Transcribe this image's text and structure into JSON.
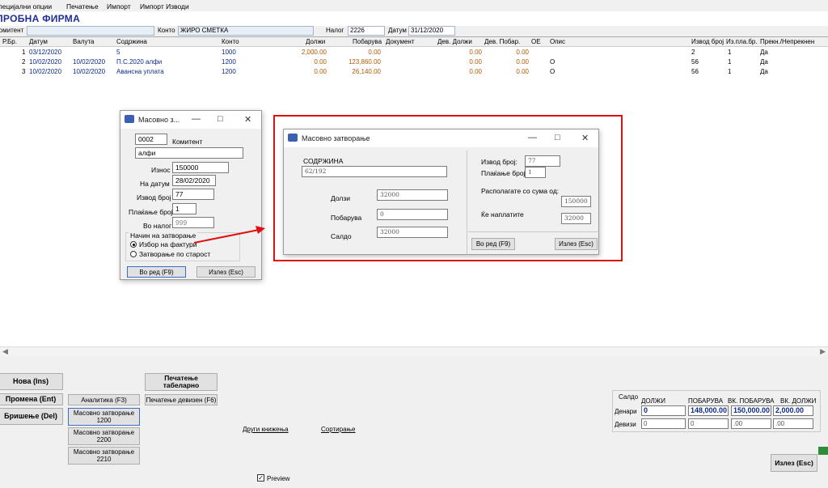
{
  "menu": [
    "Специјални опции",
    "Печатење",
    "Импорт",
    "Импорт Изводи"
  ],
  "company": "ПРОБНА ФИРМА",
  "filter": {
    "komitent_label": "Комитент",
    "konto_label": "Конто",
    "konto_value": "ЖИРО СМЕТКА",
    "nalog_label": "Налог",
    "nalog_value": "2226",
    "datum_label": "Датум",
    "datum_value": "31/12/2020"
  },
  "grid": {
    "headers": [
      "Р.Бр.",
      "Датум",
      "Валута",
      "Содржина",
      "Конто",
      "Должи",
      "Побарува",
      "Документ",
      "Дев. Должи",
      "Дев. Побар.",
      "ОЕ",
      "Опис",
      "Извод број",
      "Из.пла.бр.",
      "Прекн./Непрекнен"
    ],
    "rows": [
      {
        "rbr": "1",
        "datum": "03/12/2020",
        "valuta": "",
        "sodrzina": "5",
        "konto": "1000",
        "dolzi": "2,000.00",
        "pobaruva": "0.00",
        "dokument": "",
        "dev_dolzi": "0.00",
        "dev_pobar": "0.00",
        "oe": "",
        "opis": "",
        "izvod": "2",
        "izpla": "1",
        "preknen": "Да"
      },
      {
        "rbr": "2",
        "datum": "10/02/2020",
        "valuta": "10/02/2020",
        "sodrzina": "П.С.2020 алфи",
        "konto": "1200",
        "dolzi": "0.00",
        "pobaruva": "123,860.00",
        "dokument": "",
        "dev_dolzi": "0.00",
        "dev_pobar": "0.00",
        "oe": "О",
        "opis": "",
        "izvod": "56",
        "izpla": "1",
        "preknen": "Да"
      },
      {
        "rbr": "3",
        "datum": "10/02/2020",
        "valuta": "10/02/2020",
        "sodrzina": "Авансна уплата",
        "konto": "1200",
        "dolzi": "0.00",
        "pobaruva": "26,140.00",
        "dokument": "",
        "dev_dolzi": "0.00",
        "dev_pobar": "0.00",
        "oe": "О",
        "opis": "",
        "izvod": "56",
        "izpla": "1",
        "preknen": "Да"
      }
    ]
  },
  "buttons": {
    "nova": "Нова (Ins)",
    "promena": "Промена (Ent)",
    "brisenje": "Бришење (Del)",
    "pecatenje_tab": "Печатење табеларно",
    "analitika": "Аналитика (F3)",
    "pecatenje_dev": "Печатење девизен (F6)",
    "masovno_1200": "Масовно затворање 1200",
    "masovno_2200": "Масовно затворање 2200",
    "masovno_2210": "Масовно затворање 2210",
    "drugi": "Други книжења",
    "sortiranje": "Сортирање",
    "preview": "Preview",
    "izlez": "Излез (Esc)"
  },
  "saldo": {
    "title": "Салдо",
    "cols": [
      "ДОЛЖИ",
      "ПОБАРУВА",
      "ВК. ПОБАРУВА",
      "ВК. ДОЛЖИ"
    ],
    "denari_label": "Денари",
    "devizi_label": "Девизи",
    "denari": [
      "0",
      "148,000.00",
      "150,000.00",
      "2,000.00"
    ],
    "devizi": [
      "0",
      "0",
      ".00",
      ".00"
    ]
  },
  "dlg1": {
    "title": "Масовно з...",
    "code": "0002",
    "komitent_label": "Комитент",
    "komitent_value": "алфи",
    "iznos_label": "Износ",
    "iznos_value": "150000",
    "na_datum_label": "На датум",
    "na_datum_value": "28/02/2020",
    "izvod_label": "Извод број",
    "izvod_value": "77",
    "plakanje_label": "Плаќање број",
    "plakanje_value": "1",
    "vo_nalog_label": "Во налог",
    "vo_nalog_value": "999",
    "nacin_label": "Начин на затворање",
    "opt1": "Избор на фактури",
    "opt2": "Затворање по старост",
    "vo_red": "Во ред (F9)",
    "izlez": "Излез (Esc)"
  },
  "dlg2": {
    "title": "Масовно затворање",
    "sodrzina_label": "СОДРЖИНА",
    "sodrzina_value": "62/192",
    "dolzi_label": "Долзи",
    "dolzi_value": "32000",
    "pobaruva_label": "Побарува",
    "pobaruva_value": "0",
    "saldo_label": "Салдо",
    "saldo_value": "32000",
    "izvod_label": "Извод број:",
    "izvod_value": "77",
    "plakanje_label": "Плаќање број:",
    "plakanje_value": "1",
    "raspolagate_label": "Располагате со сума од:",
    "raspolagate_value": "150000",
    "kenaplatite_label": "Ќе наплатите",
    "kenaplatite_value": "32000",
    "vo_red": "Во ред (F9)",
    "izlez": "Излез (Esc)"
  },
  "colors": {
    "accent": "#1f2d96",
    "highlight": "#e01010",
    "orange": "#b05a00"
  }
}
